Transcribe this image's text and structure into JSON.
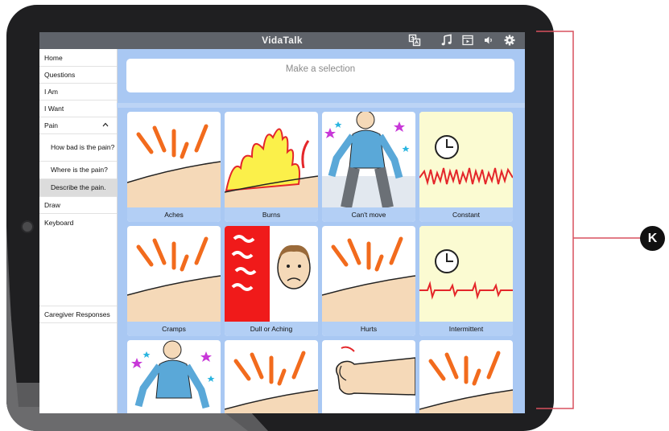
{
  "app": {
    "title": "VidaTalk"
  },
  "toolbar": {
    "icons": [
      "translate-icon",
      "music-icon",
      "video-icon",
      "volume-icon",
      "gear-icon"
    ]
  },
  "sidebar": {
    "items": [
      {
        "label": "Home"
      },
      {
        "label": "Questions"
      },
      {
        "label": "I Am"
      },
      {
        "label": "I Want"
      },
      {
        "label": "Pain"
      },
      {
        "label": "How bad is the pain?"
      },
      {
        "label": "Where is the pain?"
      },
      {
        "label": "Describe the pain."
      },
      {
        "label": "Draw"
      },
      {
        "label": "Keyboard"
      }
    ],
    "caregiver": "Caregiver Responses"
  },
  "selection": {
    "placeholder": "Make a selection"
  },
  "tiles": [
    {
      "label": "Aches",
      "icon": "ache-lines-icon"
    },
    {
      "label": "Burns",
      "icon": "flames-icon"
    },
    {
      "label": "Can't move",
      "icon": "stiff-person-icon"
    },
    {
      "label": "Constant",
      "icon": "clock-constant-icon"
    },
    {
      "label": "Cramps",
      "icon": "ache-lines-icon"
    },
    {
      "label": "Dull or Aching",
      "icon": "dull-face-icon"
    },
    {
      "label": "Hurts",
      "icon": "ache-lines-icon"
    },
    {
      "label": "Intermittent",
      "icon": "clock-intermittent-icon"
    },
    {
      "label": "",
      "icon": "stiff-person-icon"
    },
    {
      "label": "",
      "icon": "ache-lines-icon"
    },
    {
      "label": "",
      "icon": "hand-icon"
    },
    {
      "label": "",
      "icon": "ache-lines-icon"
    }
  ],
  "annotation": {
    "badge": "K"
  },
  "colors": {
    "topbar": "#5f636a",
    "content_bg": "#a9c8f3",
    "tile_label_bg": "#b3cff5",
    "accent_orange": "#f26b1d",
    "skin": "#f5d9b8"
  }
}
